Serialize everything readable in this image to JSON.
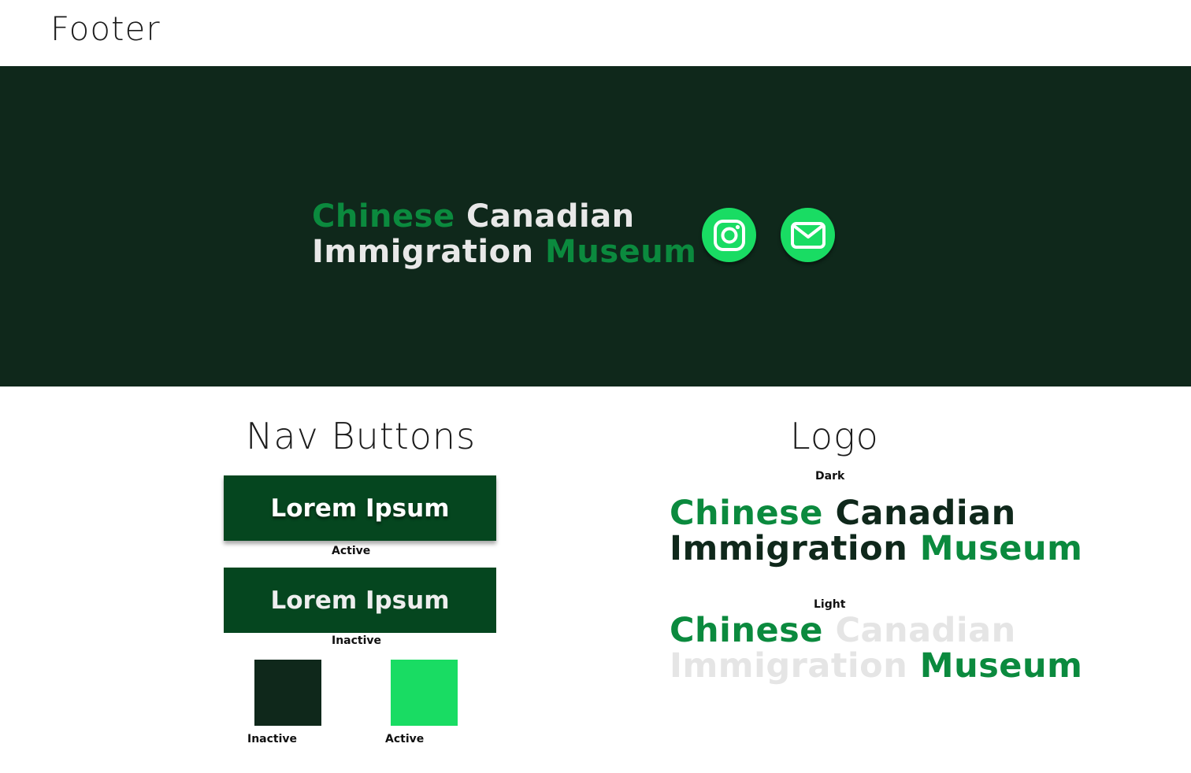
{
  "footer": {
    "title": "Footer",
    "logo": {
      "word1": "Chinese",
      "word2": "Canadian",
      "word3": "Immigration",
      "word4": "Museum"
    },
    "social": [
      {
        "icon": "instagram-icon"
      },
      {
        "icon": "mail-icon"
      }
    ]
  },
  "nav_buttons": {
    "title": "Nav Buttons",
    "active_label": "Lorem Ipsum",
    "active_caption": "Active",
    "inactive_label": "Lorem Ipsum",
    "inactive_caption": "Inactive",
    "swatch_inactive_caption": "Inactive",
    "swatch_active_caption": "Active"
  },
  "logo_section": {
    "title": "Logo",
    "dark_caption": "Dark",
    "light_caption": "Light",
    "dark_logo": {
      "word1": "Chinese",
      "word2": "Canadian",
      "word3": "Immigration",
      "word4": "Museum"
    },
    "light_logo": {
      "word1": "Chinese",
      "word2": "Canadian",
      "word3": "Immigration",
      "word4": "Museum"
    }
  },
  "colors": {
    "footer_bg": "#0f281b",
    "brand_green": "#0b8a3e",
    "accent_green": "#19dc63",
    "button_bg": "#05461f"
  }
}
